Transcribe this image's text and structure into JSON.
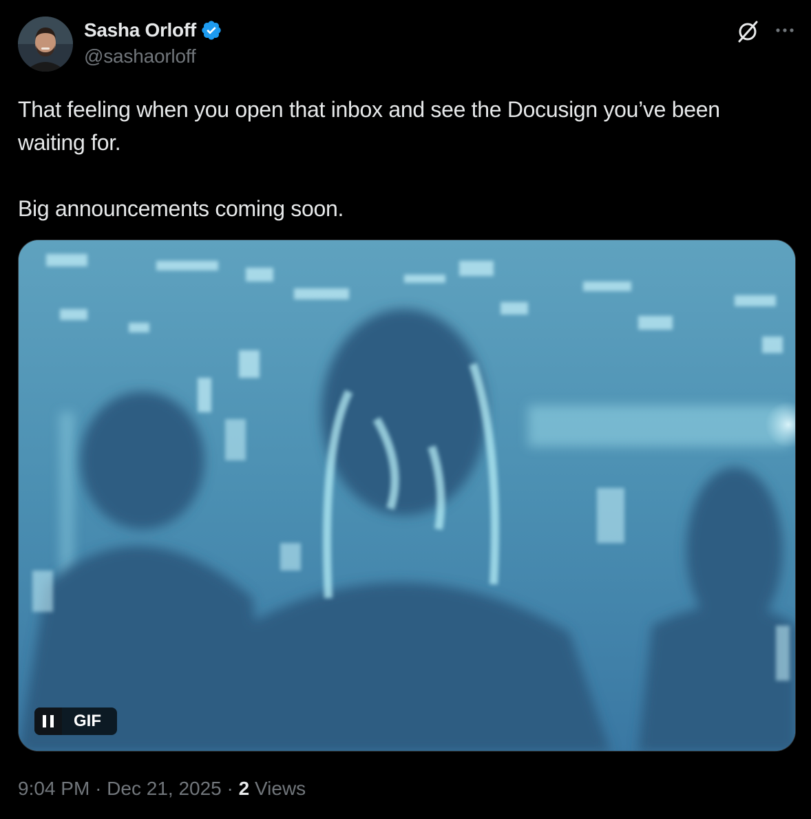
{
  "author": {
    "display_name": "Sasha Orloff",
    "handle": "@sashaorloff",
    "verified": true,
    "verified_color": "#1d9bf0"
  },
  "tweet": {
    "lines": [
      "That feeling when you open that inbox and see the Docusign you’ve been waiting for.",
      "Big announcements coming soon."
    ]
  },
  "media": {
    "type": "gif",
    "badge_label": "GIF",
    "control_icon": "pause-icon"
  },
  "meta": {
    "time": "9:04 PM",
    "separator": "·",
    "date": "Dec 21, 2025",
    "views_count": "2",
    "views_label": "Views"
  },
  "icons": {
    "grok": "grok-icon",
    "more": "more-icon"
  },
  "colors": {
    "background": "#000000",
    "text_primary": "#e7e9ea",
    "text_secondary": "#71767b"
  }
}
